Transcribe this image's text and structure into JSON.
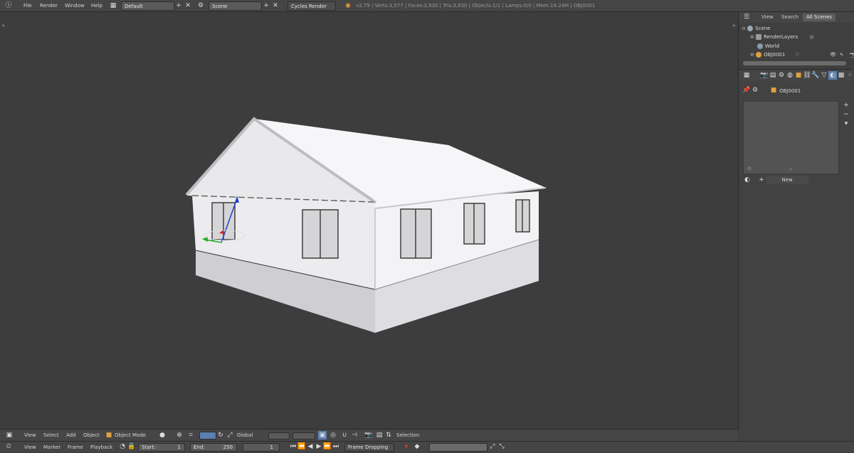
{
  "top_menu": {
    "file": "File",
    "render": "Render",
    "window": "Window",
    "help": "Help",
    "screen_layout": "Default",
    "scene": "Scene",
    "render_engine": "Cycles Render",
    "stats": "v2.79 | Verts:3,577 | Faces:3,930 | Tris:3,930 | Objects:1/1 | Lamps:0/0 | Mem:19.24M | OBJ0001"
  },
  "outliner": {
    "tabs": [
      "View",
      "Search",
      "All Scenes"
    ],
    "active_tab": "All Scenes",
    "tree": {
      "scene": "Scene",
      "render_layers": "RenderLayers",
      "world": "World",
      "object": "OBJ0001"
    }
  },
  "properties": {
    "object_name": "OBJ0001",
    "new_button": "New"
  },
  "viewport_footer": {
    "view": "View",
    "select": "Select",
    "add": "Add",
    "object": "Object",
    "mode": "Object Mode",
    "orientation": "Global",
    "selection": "Selection"
  },
  "timeline": {
    "view": "View",
    "marker": "Marker",
    "frame": "Frame",
    "playback": "Playback",
    "start_label": "Start:",
    "start_value": "1",
    "end_label": "End:",
    "end_value": "250",
    "current_frame": "1",
    "sync_mode": "Frame Dropping"
  },
  "colors": {
    "background": "#3d3d3d",
    "header": "#454545",
    "active_tab": "#5c5c5c",
    "manipulator_x": "#d02020",
    "manipulator_y": "#20b020",
    "manipulator_z": "#2040d0",
    "record": "#c83c2c"
  }
}
